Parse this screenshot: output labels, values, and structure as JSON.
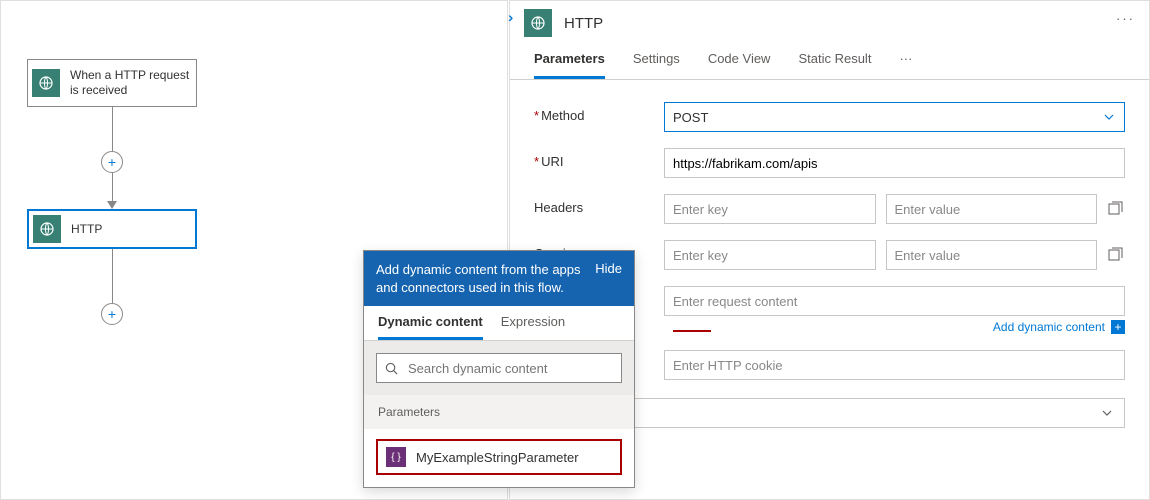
{
  "canvas": {
    "trigger_label": "When a HTTP request is received",
    "action_label": "HTTP"
  },
  "panel": {
    "title": "HTTP",
    "tabs": {
      "parameters": "Parameters",
      "settings": "Settings",
      "codeview": "Code View",
      "staticresult": "Static Result"
    },
    "fields": {
      "method_label": "Method",
      "method_value": "POST",
      "uri_label": "URI",
      "uri_value": "https://fabrikam.com/apis",
      "headers_label": "Headers",
      "queries_label": "Queries",
      "key_placeholder": "Enter key",
      "value_placeholder": "Enter value",
      "body_placeholder": "Enter request content",
      "cookie_placeholder": "Enter HTTP cookie",
      "add_dynamic_content": "Add dynamic content"
    }
  },
  "dyn": {
    "banner_text": "Add dynamic content from the apps and connectors used in this flow.",
    "hide": "Hide",
    "tab_dynamic": "Dynamic content",
    "tab_expression": "Expression",
    "search_placeholder": "Search dynamic content",
    "section_parameters": "Parameters",
    "item_name": "MyExampleStringParameter"
  }
}
